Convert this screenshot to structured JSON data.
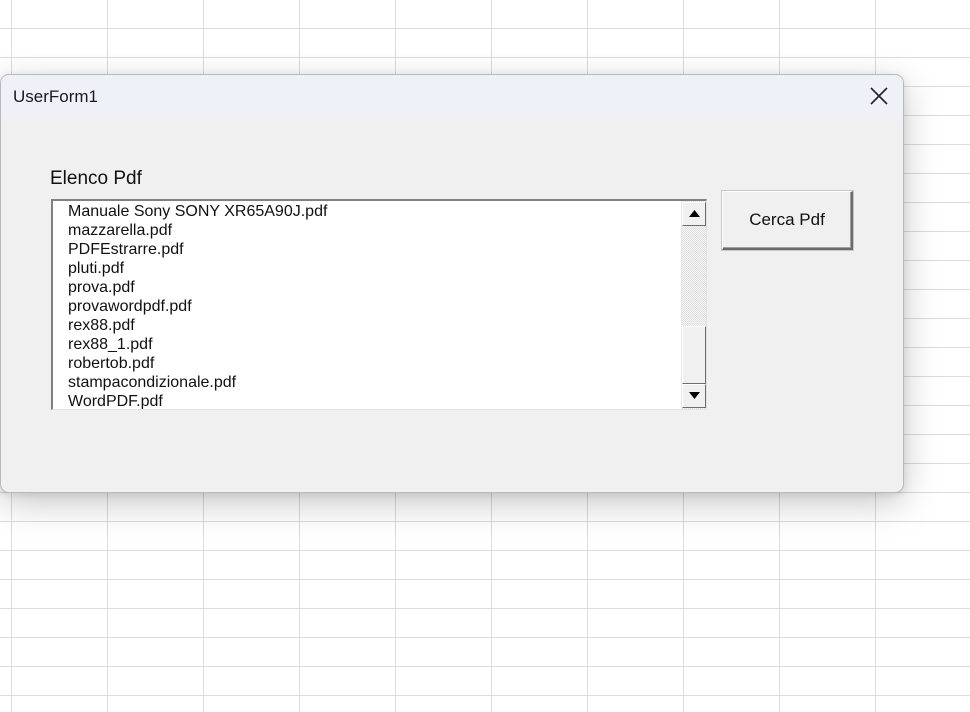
{
  "dialog": {
    "title": "UserForm1",
    "close_icon": "close-icon"
  },
  "listbox": {
    "label": "Elenco Pdf",
    "items": [
      "Manuale Sony SONY XR65A90J.pdf",
      "mazzarella.pdf",
      "PDFEstrarre.pdf",
      "pluti.pdf",
      "prova.pdf",
      "provawordpdf.pdf",
      "rex88.pdf",
      "rex88_1.pdf",
      "robertob.pdf",
      "stampacondizionale.pdf",
      "WordPDF.pdf"
    ],
    "scroll_up_icon": "arrow-up-icon",
    "scroll_down_icon": "arrow-down-icon"
  },
  "buttons": {
    "search_label": "Cerca Pdf"
  }
}
